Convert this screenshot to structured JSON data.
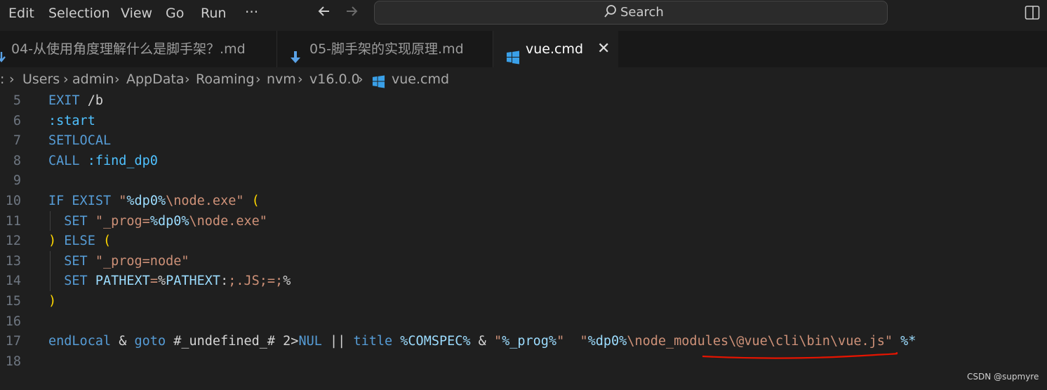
{
  "menu": {
    "items": [
      "Edit",
      "Selection",
      "View",
      "Go",
      "Run",
      "···"
    ]
  },
  "search": {
    "label": "Search"
  },
  "tabs": [
    {
      "label": "04-从使用角度理解什么是脚手架？.md"
    },
    {
      "label": "05-脚手架的实现原理.md"
    },
    {
      "label": "vue.cmd"
    }
  ],
  "breadcrumb": ":",
  "breadcrumb_items": [
    "Users",
    "admin",
    "AppData",
    "Roaming",
    "nvm",
    "v16.0.0",
    "vue.cmd"
  ],
  "editor": {
    "lines": [
      {
        "n": "5",
        "code": "EXIT /b"
      },
      {
        "n": "6",
        "code": ":start"
      },
      {
        "n": "7",
        "code": "SETLOCAL"
      },
      {
        "n": "8",
        "code": "CALL :find_dp0"
      },
      {
        "n": "9",
        "code": ""
      },
      {
        "n": "10",
        "code": "IF EXIST \"%dp0%\\node.exe\" ("
      },
      {
        "n": "11",
        "code": "  SET \"_prog=%dp0%\\node.exe\""
      },
      {
        "n": "12",
        "code": ") ELSE ("
      },
      {
        "n": "13",
        "code": "  SET \"_prog=node\""
      },
      {
        "n": "14",
        "code": "  SET PATHEXT=%PATHEXT:;.JS;=;%"
      },
      {
        "n": "15",
        "code": ")"
      },
      {
        "n": "16",
        "code": ""
      },
      {
        "n": "17",
        "code": "endLocal & goto #_undefined_# 2>NUL || title %COMSPEC% & \"%_prog%\"  \"%dp0%\\node_modules\\@vue\\cli\\bin\\vue.js\" %*"
      },
      {
        "n": "18",
        "code": ""
      }
    ]
  },
  "watermark": "CSDN @supmyre",
  "colors": {
    "keyword": "#569cd6",
    "string": "#ce9178",
    "annotation": "#e51400"
  }
}
